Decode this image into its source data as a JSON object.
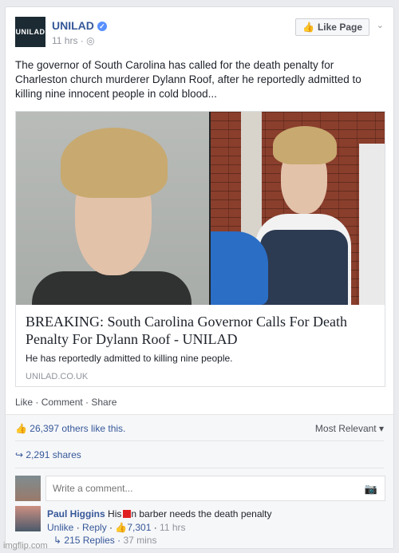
{
  "post": {
    "page_name": "UNILAD",
    "avatar_text": "UNILAD",
    "time": "11 hrs",
    "like_page_label": "Like Page",
    "text": "The governor of South Carolina has called for the death penalty for Charleston church murderer Dylann Roof, after he reportedly admitted to killing nine innocent people in cold blood..."
  },
  "link": {
    "title": "BREAKING: South Carolina Governor Calls For Death Penalty For Dylann Roof - UNILAD",
    "description": "He has reportedly admitted to killing nine people.",
    "domain": "UNILAD.CO.UK"
  },
  "actions": {
    "like": "Like",
    "comment": "Comment",
    "share": "Share"
  },
  "stats": {
    "likes": "26,397 others like this.",
    "sort": "Most Relevant",
    "shares": "2,291 shares"
  },
  "comment_input": {
    "placeholder": "Write a comment..."
  },
  "comment": {
    "author": "Paul Higgins",
    "text_before": "His",
    "text_after": "n barber needs the death penalty",
    "unlike": "Unlike",
    "reply": "Reply",
    "likes": "7,301",
    "time": "11 hrs",
    "replies": "215 Replies",
    "replies_time": "37 mins"
  },
  "watermark": "imgflip.com",
  "colors": {
    "link_blue": "#365899",
    "verified": "#5890ff",
    "redaction": "#e02020"
  }
}
